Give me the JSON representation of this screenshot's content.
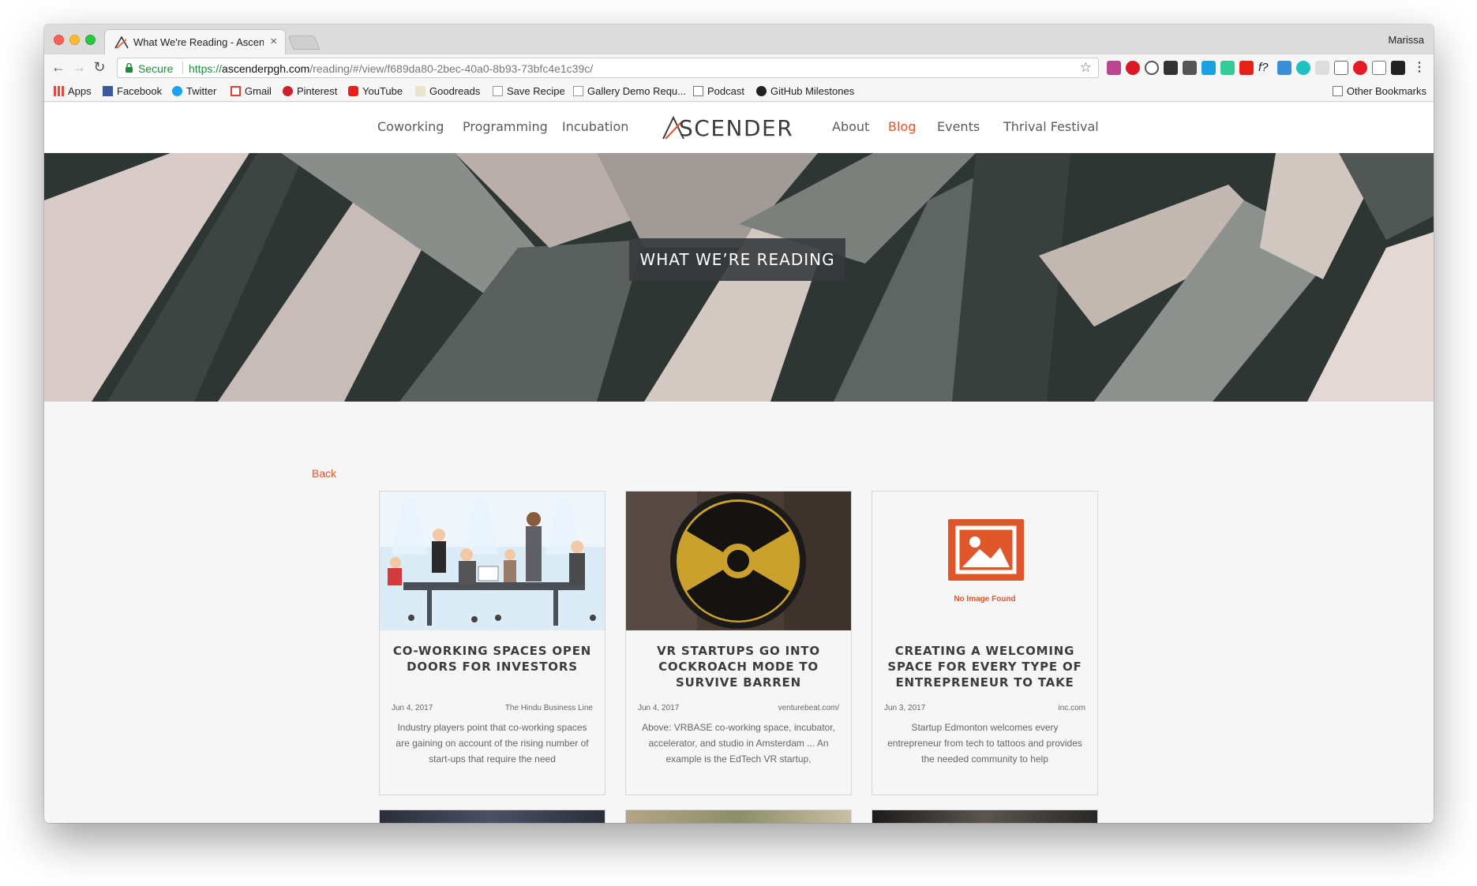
{
  "browser": {
    "tab_title": "What We're Reading - Ascender",
    "profile_name": "Marissa",
    "secure_label": "Secure",
    "url_scheme": "https://",
    "url_host": "ascenderpgh.com",
    "url_path": "/reading/#/view/f689da80-2bec-40a0-8b93-73bfc4e1c39c/"
  },
  "bookmarks": {
    "items": [
      "Apps",
      "Facebook",
      "Twitter",
      "Gmail",
      "Pinterest",
      "YouTube",
      "Goodreads",
      "Save Recipe",
      "Gallery Demo Requ...",
      "Podcast",
      "GitHub Milestones"
    ],
    "other": "Other Bookmarks"
  },
  "site": {
    "logo": "SCENDER",
    "nav_left": [
      "Coworking",
      "Programming",
      "Incubation"
    ],
    "nav_right": [
      "About",
      "Blog",
      "Events",
      "Thrival Festival"
    ],
    "active_nav": "Blog",
    "accent_color": "#e0562b"
  },
  "hero": {
    "title": "WHAT WE’RE READING"
  },
  "content": {
    "back_label": "Back",
    "cards": [
      {
        "title": "CO-WORKING SPACES OPEN DOORS FOR INVESTORS",
        "date": "Jun 4, 2017",
        "source": "The Hindu Business Line",
        "description": "Industry players point that co-working spaces are gaining on account of the rising number of start-ups that require the need"
      },
      {
        "title": "VR STARTUPS GO INTO COCKROACH MODE TO SURVIVE BARREN",
        "date": "Jun 4, 2017",
        "source": "venturebeat.com/",
        "description": "Above: VRBASE co-working space, incubator, accelerator, and studio in Amsterdam ... An example is the EdTech VR startup,"
      },
      {
        "title": "CREATING A WELCOMING SPACE FOR EVERY TYPE OF ENTREPRENEUR TO TAKE",
        "date": "Jun 3, 2017",
        "source": "inc.com",
        "description": "Startup Edmonton welcomes every entrepreneur from tech to tattoos and provides the needed community to help",
        "image_placeholder": "No Image Found"
      }
    ]
  }
}
